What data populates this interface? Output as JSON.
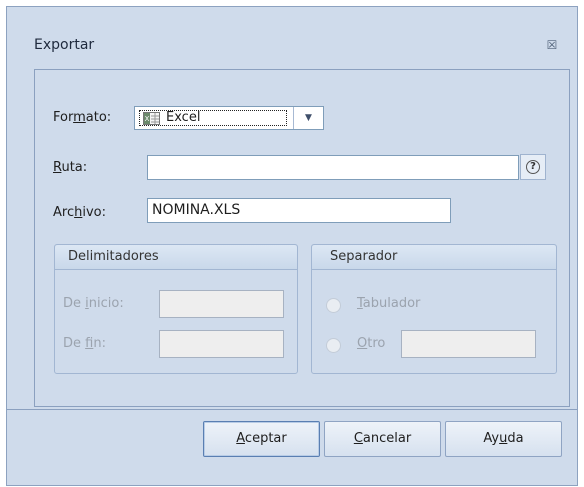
{
  "dialog": {
    "title": "Exportar",
    "close_glyph": "☒"
  },
  "format": {
    "label_pre": "For",
    "label_u": "m",
    "label_post": "ato:",
    "value": "Excel",
    "icon": "excel-file-icon"
  },
  "route": {
    "label_u": "R",
    "label_post": "uta:",
    "value": "",
    "help_glyph": "?"
  },
  "file": {
    "label_pre": "Arc",
    "label_u": "h",
    "label_post": "ivo:",
    "value": "NOMINA.XLS"
  },
  "delimiters": {
    "title": "Delimitadores",
    "start_pre": "De ",
    "start_u": "i",
    "start_post": "nicio:",
    "start_value": "",
    "end_pre": "De ",
    "end_u": "f",
    "end_post": "in:",
    "end_value": ""
  },
  "separator": {
    "title": "Separador",
    "tab_u": "T",
    "tab_post": "abulador",
    "other_u": "O",
    "other_post": "tro",
    "other_value": ""
  },
  "buttons": {
    "accept_u": "A",
    "accept_post": "ceptar",
    "cancel_u": "C",
    "cancel_post": "ancelar",
    "help_pre": "Ay",
    "help_u": "u",
    "help_post": "da"
  },
  "colors": {
    "dialog_bg": "#cfdbeb",
    "border": "#8ba0bf",
    "disabled_text": "#9ba3ae"
  }
}
